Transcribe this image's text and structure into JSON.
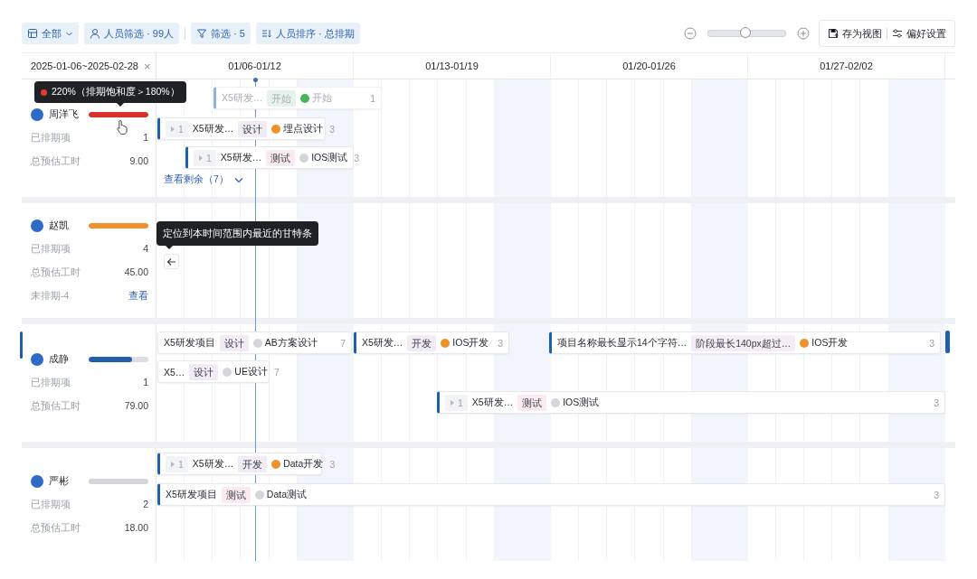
{
  "toolbar": {
    "filters": [
      {
        "label": "全部",
        "kind": "view"
      },
      {
        "label": "人员筛选 · 99人",
        "kind": "people"
      },
      {
        "label": "筛选 · 5",
        "kind": "filter"
      },
      {
        "label": "人员排序 · 总排期",
        "kind": "sort"
      }
    ],
    "zoom": {
      "level": 0.48
    },
    "actions": [
      {
        "label": "存为视图",
        "kind": "save"
      },
      {
        "label": "偏好设置",
        "kind": "settings"
      }
    ]
  },
  "date_range": {
    "label": "2025-01-06~2025-02-28",
    "clear": "×"
  },
  "weeks": [
    "01/06-01/12",
    "01/13-01/19",
    "01/20-01/26",
    "01/27-02/02"
  ],
  "people": [
    {
      "name": "周洋飞",
      "color": "#d9302a",
      "level": 1,
      "selected": false,
      "stats": [
        {
          "label": "已排期项",
          "value": "1"
        },
        {
          "label": "总预估工时",
          "value": "9.00"
        }
      ],
      "saturation_tooltip": {
        "text": "220%（排期饱和度＞180%）",
        "color": "#e8382f"
      },
      "tasks": [
        {
          "project": "X5研发…",
          "stage": {
            "label": "开始",
            "color": "#e7f2ea"
          },
          "status": "开始",
          "color": "#4cb35a",
          "count": "1",
          "dimmed": true,
          "accent": true
        },
        {
          "subtasks": "1",
          "project": "X5研发…",
          "stage": {
            "label": "设计",
            "color": "#f1ebf6"
          },
          "status": "埋点设计",
          "color": "#f0922b",
          "count": "3",
          "dimmed": false,
          "accent": true
        },
        {
          "subtasks": "1",
          "project": "X5研发…",
          "stage": {
            "label": "测试",
            "color": "#fbeaef"
          },
          "status": "IOS测试",
          "color": "#d4d6da",
          "count": "3",
          "dimmed": false,
          "accent": true
        }
      ],
      "more": "查看剩余（7）"
    },
    {
      "name": "赵凯",
      "color": "#f0922b",
      "level": 1,
      "selected": false,
      "stats": [
        {
          "label": "已排期项",
          "value": "4"
        },
        {
          "label": "总预估工时",
          "value": "45.00"
        }
      ],
      "unscheduled": {
        "label": "未排期-4",
        "link": "查看"
      },
      "locate_tooltip": "定位到本时间范围内最近的甘特条"
    },
    {
      "name": "成静",
      "color": "#1f5fad",
      "level": 0.72,
      "selected": true,
      "stats": [
        {
          "label": "已排期项",
          "value": "1"
        },
        {
          "label": "总预估工时",
          "value": "79.00"
        }
      ],
      "tasks": [
        {
          "project": "X5研发项目",
          "stage": {
            "label": "设计",
            "color": "#f1ebf6"
          },
          "status": "AB方案设计",
          "color": "#d4d6da",
          "count": "7",
          "dimmed": false,
          "accent": false
        },
        {
          "project": "X5研发…",
          "stage": {
            "label": "开发",
            "color": "#f1ebf6"
          },
          "status": "IOS开发",
          "color": "#f0922b",
          "count": "3",
          "dimmed": false,
          "accent": true
        },
        {
          "project": "项目名称最长显示14个字符…",
          "stage": {
            "label": "阶段最长140px超过…",
            "color": "#f4edf6"
          },
          "status": "IOS开发",
          "color": "#f0922b",
          "count": "3",
          "dimmed": false,
          "accent": true
        },
        {
          "project": "X5…",
          "stage": {
            "label": "设计",
            "color": "#f1ebf6"
          },
          "status": "UE设计",
          "color": "#d4d6da",
          "count": "7",
          "dimmed": false,
          "accent": false
        },
        {
          "subtasks": "1",
          "project": "X5研发…",
          "stage": {
            "label": "测试",
            "color": "#fbeaef"
          },
          "status": "IOS测试",
          "color": "#d4d6da",
          "count": "3",
          "dimmed": false,
          "accent": true
        }
      ]
    },
    {
      "name": "严彬",
      "color": "#d4d6da",
      "level": 1,
      "selected": false,
      "stats": [
        {
          "label": "已排期项",
          "value": "2"
        },
        {
          "label": "总预估工时",
          "value": "18.00"
        }
      ],
      "tasks": [
        {
          "subtasks": "1",
          "project": "X5研发…",
          "stage": {
            "label": "开发",
            "color": "#f1ebf6"
          },
          "status": "Data开发",
          "color": "#f0922b",
          "count": "3",
          "dimmed": false,
          "accent": true
        },
        {
          "project": "X5研发项目",
          "stage": {
            "label": "测试",
            "color": "#fbeaef"
          },
          "status": "Data测试",
          "color": "#d4d6da",
          "count": "3",
          "dimmed": false,
          "accent": true
        }
      ]
    }
  ]
}
